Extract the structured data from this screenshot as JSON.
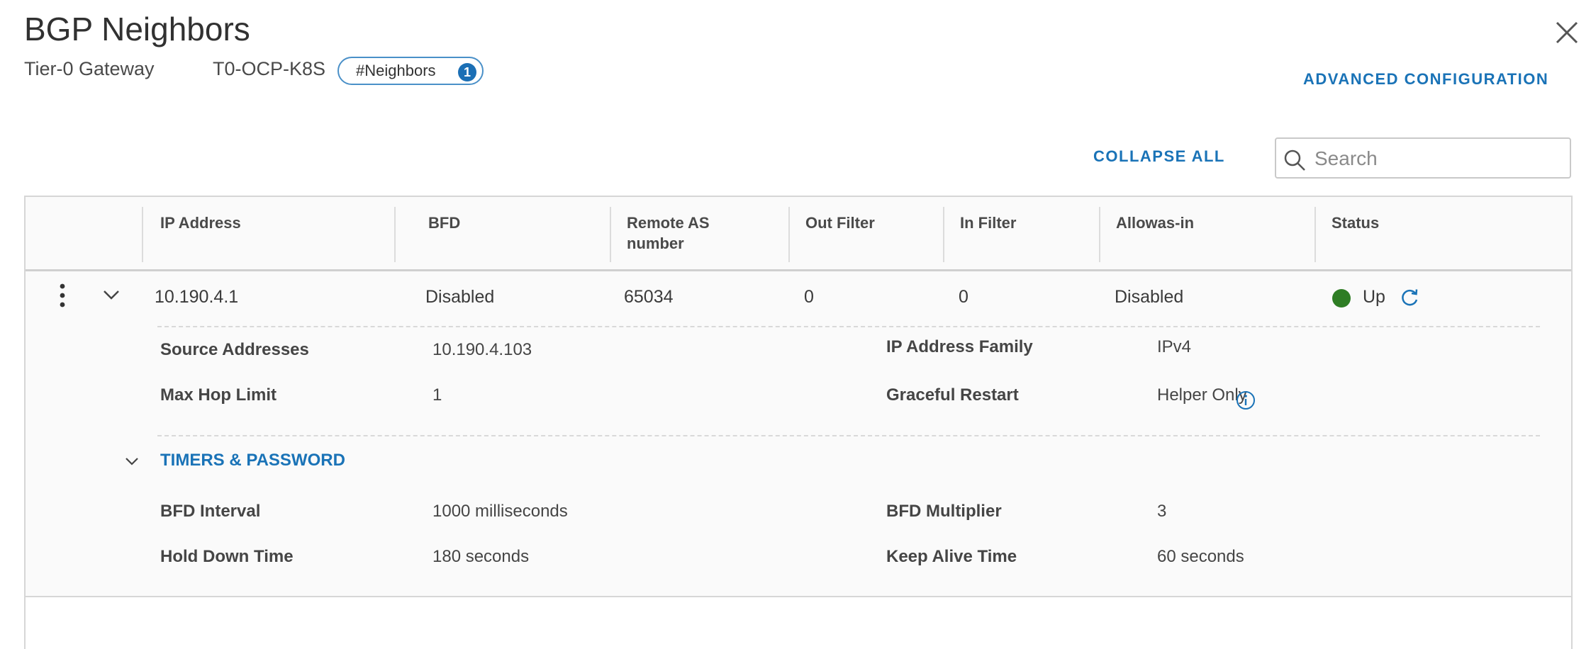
{
  "header": {
    "title": "BGP Neighbors",
    "gateway_label": "Tier-0 Gateway",
    "gateway_name": "T0-OCP-K8S",
    "neighbors_badge_label": "#Neighbors",
    "neighbors_count": "1",
    "advanced_configuration": "ADVANCED CONFIGURATION"
  },
  "toolbar": {
    "collapse_all": "COLLAPSE ALL",
    "search_placeholder": "Search"
  },
  "table": {
    "columns": [
      "IP Address",
      "BFD",
      "Remote AS number",
      "Out Filter",
      "In Filter",
      "Allowas-in",
      "Status"
    ],
    "rows": [
      {
        "ip_address": "10.190.4.1",
        "bfd": "Disabled",
        "remote_as": "65034",
        "out_filter": "0",
        "in_filter": "0",
        "allowas_in": "Disabled",
        "status": "Up",
        "details": {
          "source_addresses_label": "Source Addresses",
          "source_addresses": "10.190.4.103",
          "ip_family_label": "IP Address Family",
          "ip_family": "IPv4",
          "max_hop_label": "Max Hop Limit",
          "max_hop": "1",
          "graceful_restart_label": "Graceful Restart",
          "graceful_restart": "Helper Only",
          "timers_title": "TIMERS & PASSWORD",
          "bfd_interval_label": "BFD Interval",
          "bfd_interval": "1000 milliseconds",
          "bfd_multiplier_label": "BFD Multiplier",
          "bfd_multiplier": "3",
          "hold_down_label": "Hold Down Time",
          "hold_down": "180 seconds",
          "keep_alive_label": "Keep Alive Time",
          "keep_alive": "60 seconds"
        }
      }
    ]
  },
  "colors": {
    "accent": "#1a73b7",
    "status_up": "#2e7d24"
  },
  "icons": [
    "close-icon",
    "search-icon",
    "kebab-menu-icon",
    "chevron-down-icon",
    "refresh-icon",
    "info-icon"
  ]
}
